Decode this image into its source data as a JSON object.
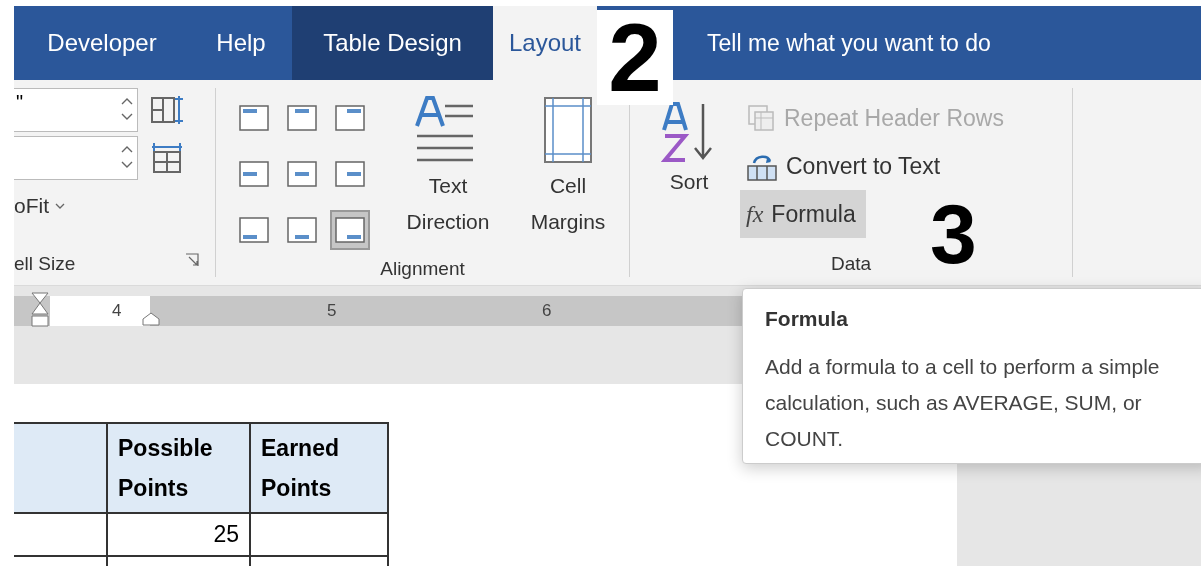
{
  "tabs": [
    {
      "label": "Developer",
      "selected": false,
      "kind": "normal"
    },
    {
      "label": "Help",
      "selected": false,
      "kind": "normal"
    },
    {
      "label": "Table Design",
      "selected": false,
      "kind": "contextual"
    },
    {
      "label": "Layout",
      "selected": true,
      "kind": "contextual"
    }
  ],
  "tell_me": "Tell me what you want to do",
  "annotations": [
    {
      "text": "2",
      "kind": "boxed"
    },
    {
      "text": "3",
      "kind": "plain"
    }
  ],
  "cell_size": {
    "height_field": {
      "value": "\""
    },
    "autofit": "oFit",
    "group_label": "ell Size"
  },
  "alignment": {
    "buttons": [
      {
        "selected": false
      },
      {
        "selected": false
      },
      {
        "selected": false
      },
      {
        "selected": false
      },
      {
        "selected": false
      },
      {
        "selected": false
      },
      {
        "selected": false
      },
      {
        "selected": false
      },
      {
        "selected": true
      }
    ],
    "text_direction": "Text Direction",
    "cell_margins": "Cell Margins",
    "group_label": "Alignment"
  },
  "data": {
    "sort": "Sort",
    "items": [
      {
        "label": "Repeat Header Rows",
        "kind": "repeat",
        "disabled": true,
        "highlighted": false
      },
      {
        "label": "Convert to Text",
        "kind": "convert",
        "disabled": false,
        "highlighted": false
      },
      {
        "label": "Formula",
        "kind": "formula",
        "icon": "fx",
        "disabled": false,
        "highlighted": true
      }
    ],
    "group_label": "Data"
  },
  "ruler": {
    "numbers": [
      "4",
      "5",
      "6"
    ]
  },
  "tooltip": {
    "title": "Formula",
    "text": "Add a formula to a cell to perform a simple calculation, such as AVERAGE, SUM, or COUNT."
  },
  "table": {
    "columns": [
      "Possible Points",
      "Earned Points"
    ],
    "rows": [
      {
        "possible_points": "25"
      }
    ]
  }
}
